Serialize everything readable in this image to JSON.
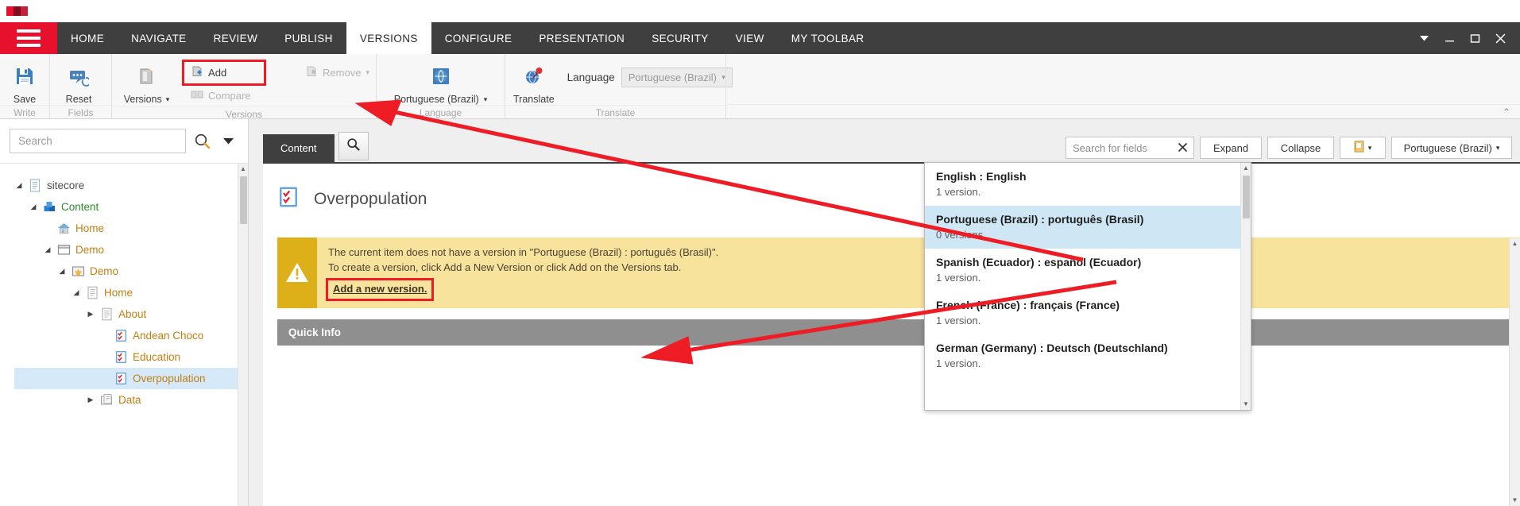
{
  "window": {
    "controls": {
      "dropdown": "chevron-down",
      "minimize": "minimize",
      "maximize": "maximize",
      "close": "close"
    }
  },
  "menubar": {
    "hamburger": "menu-icon",
    "tabs": [
      {
        "label": "HOME",
        "active": false
      },
      {
        "label": "NAVIGATE",
        "active": false
      },
      {
        "label": "REVIEW",
        "active": false
      },
      {
        "label": "PUBLISH",
        "active": false
      },
      {
        "label": "VERSIONS",
        "active": true
      },
      {
        "label": "CONFIGURE",
        "active": false
      },
      {
        "label": "PRESENTATION",
        "active": false
      },
      {
        "label": "SECURITY",
        "active": false
      },
      {
        "label": "VIEW",
        "active": false
      },
      {
        "label": "MY TOOLBAR",
        "active": false
      }
    ]
  },
  "ribbon": {
    "groups": [
      {
        "label": "Write",
        "buttons": [
          {
            "label": "Save",
            "icon": "save-icon"
          }
        ]
      },
      {
        "label": "Fields",
        "buttons": [
          {
            "label": "Reset",
            "icon": "reset-icon"
          }
        ]
      },
      {
        "label": "Versions",
        "buttons": [
          {
            "label": "Versions",
            "icon": "versions-icon",
            "caret": "▾"
          }
        ],
        "small": [
          {
            "label": "Add",
            "icon": "add-version-icon",
            "disabled": false,
            "highlighted": true
          },
          {
            "label": "Compare",
            "icon": "compare-icon",
            "disabled": true
          },
          {
            "label": "Remove",
            "icon": "remove-version-icon",
            "disabled": true,
            "caret": "▾"
          }
        ]
      },
      {
        "label": "Language",
        "buttons": [
          {
            "label": "Portuguese (Brazil)",
            "icon": "globe-icon",
            "caret": "▾"
          }
        ]
      },
      {
        "label": "Translate",
        "buttons": [
          {
            "label": "Translate",
            "icon": "translate-globe-pin-icon"
          }
        ],
        "field": {
          "label": "Language",
          "value": "Portuguese (Brazil)",
          "caret": "▾"
        }
      }
    ]
  },
  "sidebar": {
    "search": {
      "placeholder": "Search",
      "value": "",
      "icon": "search-icon",
      "dropdown_icon": "chevron-down-icon"
    },
    "tree": [
      {
        "label": "sitecore",
        "indent": 0,
        "arrow": "expanded",
        "icon": "document-icon",
        "color": "gray",
        "selected": false
      },
      {
        "label": "Content",
        "indent": 1,
        "arrow": "expanded",
        "icon": "content-cubes-icon",
        "color": "green",
        "selected": false
      },
      {
        "label": "Home",
        "indent": 2,
        "arrow": "none",
        "icon": "home-icon",
        "color": "orange",
        "selected": false
      },
      {
        "label": "Demo",
        "indent": 2,
        "arrow": "expanded",
        "icon": "window-icon",
        "color": "orange",
        "selected": false
      },
      {
        "label": "Demo",
        "indent": 3,
        "arrow": "expanded",
        "icon": "star-icon",
        "color": "orange",
        "selected": false
      },
      {
        "label": "Home",
        "indent": 4,
        "arrow": "expanded",
        "icon": "page-icon",
        "color": "orange",
        "selected": false
      },
      {
        "label": "About",
        "indent": 5,
        "arrow": "collapsed",
        "icon": "page-icon",
        "color": "orange",
        "selected": false
      },
      {
        "label": "Andean Choco",
        "indent": 6,
        "arrow": "none",
        "icon": "checklist-icon",
        "color": "orange",
        "selected": false
      },
      {
        "label": "Education",
        "indent": 6,
        "arrow": "none",
        "icon": "checklist-icon",
        "color": "orange",
        "selected": false
      },
      {
        "label": "Overpopulation",
        "indent": 6,
        "arrow": "none",
        "icon": "checklist-icon",
        "color": "orange",
        "selected": true
      },
      {
        "label": "Data",
        "indent": 5,
        "arrow": "collapsed",
        "icon": "folder-page-icon",
        "color": "orange",
        "selected": false
      }
    ]
  },
  "content": {
    "tabs": [
      {
        "label": "Content",
        "active": true
      }
    ],
    "search_tab_icon": "search-icon",
    "toolbar": {
      "field_search": {
        "value": "Search for fields",
        "clear_icon": "close-icon"
      },
      "expand": "Expand",
      "collapse": "Collapse",
      "view_icon": "ruler-icon",
      "view_caret": "▾",
      "language": "Portuguese (Brazil)",
      "language_caret": "▾"
    },
    "item": {
      "title": "Overpopulation",
      "icon": "checklist-icon"
    },
    "warning": {
      "icon": "warning-icon",
      "line1": "The current item does not have a version in \"Portuguese (Brazil) : português (Brasil)\".",
      "line2": "To create a version, click Add a New Version or click Add on the Versions tab.",
      "link": "Add a new version."
    },
    "section": {
      "title": "Quick Info"
    }
  },
  "language_panel": {
    "items": [
      {
        "name": "English : English",
        "versions": "1 version.",
        "selected": false
      },
      {
        "name": "Portuguese (Brazil) : português (Brasil)",
        "versions": "0 versions.",
        "selected": true
      },
      {
        "name": "Spanish (Ecuador) : español (Ecuador)",
        "versions": "1 version.",
        "selected": false
      },
      {
        "name": "French (France) : français (France)",
        "versions": "1 version.",
        "selected": false
      },
      {
        "name": "German (Germany) : Deutsch (Deutschland)",
        "versions": "1 version.",
        "selected": false
      }
    ]
  },
  "colors": {
    "accent_red": "#e8112d",
    "menu_bg": "#3f3f3f",
    "warning_bg": "#f8e39c",
    "warning_icon_bg": "#ddaf19",
    "selection_blue": "#cfe7f5",
    "annotation_red": "#ee1c25"
  }
}
